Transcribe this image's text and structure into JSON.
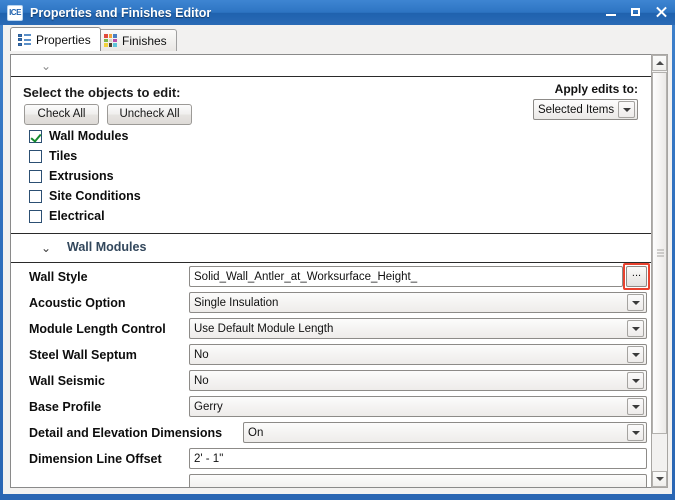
{
  "window": {
    "title": "Properties and Finishes Editor",
    "app_icon": "ICE",
    "minimize_label": "Minimize",
    "maximize_label": "Maximize",
    "close_label": "Close"
  },
  "tabs": [
    {
      "label": "Properties",
      "icon": "list-icon",
      "active": true
    },
    {
      "label": "Finishes",
      "icon": "color-grid-icon",
      "active": false
    }
  ],
  "finishes_icon_colors": [
    "#e04a3c",
    "#f0a33a",
    "#4a7fc1",
    "#7fb648",
    "#d9d3c8",
    "#b94ea8",
    "#f2d23c",
    "#4a3f2f",
    "#5ec3d8"
  ],
  "collapse_chevron": "⌄",
  "objects_panel": {
    "heading": "Select the objects to edit:",
    "check_all_label": "Check All",
    "uncheck_all_label": "Uncheck All",
    "apply_label": "Apply edits to:",
    "apply_value": "Selected Items",
    "items": [
      {
        "label": "Wall Modules",
        "checked": true
      },
      {
        "label": "Tiles",
        "checked": false
      },
      {
        "label": "Extrusions",
        "checked": false
      },
      {
        "label": "Site Conditions",
        "checked": false
      },
      {
        "label": "Electrical",
        "checked": false
      }
    ]
  },
  "group": {
    "chevron": "⌄",
    "name": "Wall Modules"
  },
  "properties": [
    {
      "label": "Wall Style",
      "value": "Solid_Wall_Antler_at_Worksurface_Height_",
      "control": "text-browse",
      "browse_label": "...",
      "highlighted": true
    },
    {
      "label": "Acoustic Option",
      "value": "Single Insulation",
      "control": "combo"
    },
    {
      "label": "Module Length Control",
      "value": "Use Default Module Length",
      "control": "combo"
    },
    {
      "label": "Steel Wall Septum",
      "value": "No",
      "control": "combo"
    },
    {
      "label": "Wall Seismic",
      "value": "No",
      "control": "combo"
    },
    {
      "label": "Base Profile",
      "value": "Gerry",
      "control": "combo"
    },
    {
      "label": "Detail and Elevation Dimensions",
      "value": "On",
      "control": "combo"
    },
    {
      "label": "Dimension Line Offset",
      "value": "2' - 1\"",
      "control": "text"
    }
  ],
  "scrollbar": {
    "up_label": "Scroll up",
    "down_label": "Scroll down"
  },
  "colors": {
    "titlebar_blue": "#2d74c2",
    "highlight_red": "#e8422e",
    "check_green": "#148a2e",
    "group_header": "#32475c"
  }
}
